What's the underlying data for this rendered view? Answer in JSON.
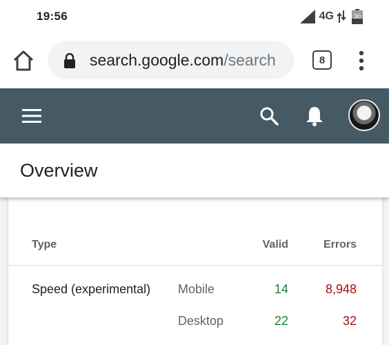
{
  "status_bar": {
    "time": "19:56",
    "network": "4G",
    "battery_level": "30",
    "icons": [
      "signal-icon",
      "data-transfer-icon",
      "battery-icon"
    ]
  },
  "browser": {
    "url_host": "search.google.com",
    "url_path": "/search",
    "tab_count": "8",
    "icons": [
      "home-icon",
      "lock-icon",
      "more-vert-icon"
    ]
  },
  "app_bar": {
    "icons": [
      "menu-icon",
      "search-icon",
      "bell-icon",
      "avatar"
    ],
    "color": "#455a64"
  },
  "page": {
    "title": "Overview"
  },
  "table": {
    "headers": {
      "type": "Type",
      "valid": "Valid",
      "errors": "Errors"
    },
    "rows": [
      {
        "type": "Speed (experimental)",
        "device": "Mobile",
        "valid": "14",
        "errors": "8,948"
      },
      {
        "type": "",
        "device": "Desktop",
        "valid": "22",
        "errors": "32"
      }
    ],
    "colors": {
      "valid": "#188038",
      "errors": "#a50e0e"
    }
  }
}
